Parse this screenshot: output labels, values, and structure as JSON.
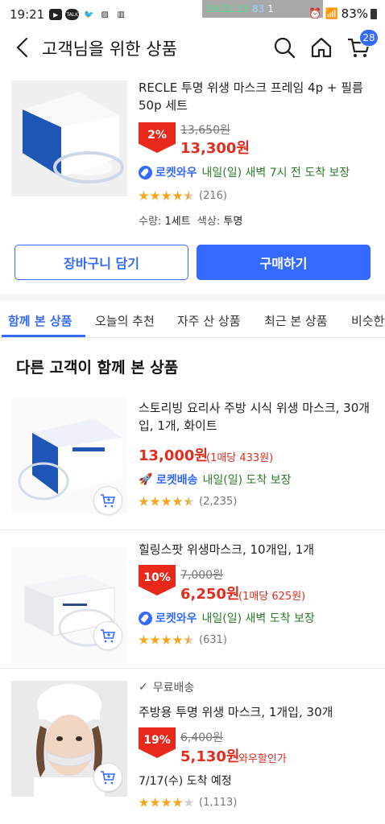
{
  "status_bar": {
    "time": "19:21",
    "overlay_time": "19:21:13",
    "overlay_num1": "83",
    "overlay_num2": "1",
    "battery": "83%"
  },
  "header": {
    "title": "고객님을 위한 상품",
    "cart_count": "28"
  },
  "top_product": {
    "title": "RECLE 투명 위생 마스크 프레임 4p + 필름 50p 세트",
    "discount": "2%",
    "original_price": "13,650원",
    "price": "13,300원",
    "rocket_label": "로켓와우",
    "delivery": "내일(일) 새벽 7시 전 도착 보장",
    "rating": 4.5,
    "reviews": "(216)",
    "qty_label": "수량:",
    "qty_value": "1세트",
    "color_label": "색상:",
    "color_value": "투명"
  },
  "buttons": {
    "cart": "장바구니 담기",
    "buy": "구매하기"
  },
  "tabs": [
    {
      "label": "함께 본 상품",
      "active": true
    },
    {
      "label": "오늘의 추천"
    },
    {
      "label": "자주 산 상품"
    },
    {
      "label": "최근 본 상품"
    },
    {
      "label": "비슷한"
    }
  ],
  "section_title": "다른 고객이 함께 본 상품",
  "items": [
    {
      "title": "스토리빙 요리사 주방 시식 위생 마스크, 30개입, 1개, 화이트",
      "price": "13,000원",
      "unit_price": "(1매당 433원)",
      "rocket_label": "로켓배송",
      "delivery": "내일(일) 도착 보장",
      "rating": 4.5,
      "reviews": "(2,235)"
    },
    {
      "title": "힐링스팟 위생마스크, 10개입, 1개",
      "discount": "10%",
      "original_price": "7,000원",
      "price": "6,250원",
      "unit_price": "(1매당 625원)",
      "rocket_label": "로켓와우",
      "delivery": "내일(일) 새벽 도착 보장",
      "rating": 4.5,
      "reviews": "(631)"
    },
    {
      "free_shipping": "무료배송",
      "title": "주방용 투명 위생 마스크, 1개입, 30개",
      "discount": "19%",
      "original_price": "6,400원",
      "price": "5,130원",
      "wow_discount": "와우할인가",
      "arrival": "7/17(수) 도착 예정",
      "rating": 4.0,
      "reviews": "(1,113)"
    }
  ],
  "colors": {
    "accent": "#346aff",
    "price_red": "#e02d1f",
    "badge_red": "#e8281a",
    "delivery_green": "#2a7b2a",
    "star": "#f5a623"
  }
}
